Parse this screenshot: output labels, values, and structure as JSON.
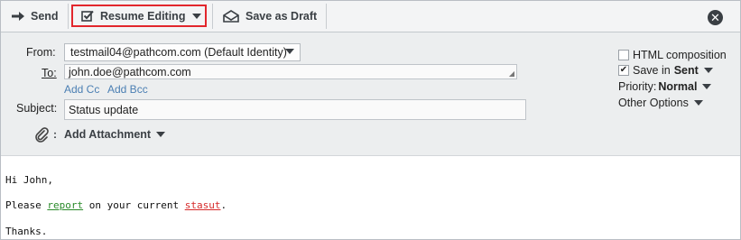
{
  "toolbar": {
    "send_label": "Send",
    "resume_label": "Resume Editing",
    "draft_label": "Save as Draft",
    "close_glyph": "✕"
  },
  "header": {
    "from_label": "From:",
    "from_value": "testmail04@pathcom.com (Default Identity)",
    "to_label": "To:",
    "to_value": "john.doe@pathcom.com",
    "add_cc": "Add Cc",
    "add_bcc": "Add Bcc",
    "subject_label": "Subject:",
    "subject_value": "Status update",
    "attach_separator": ":",
    "attach_label": "Add Attachment",
    "html_composition": "HTML composition",
    "save_in": "Save in",
    "save_in_folder": "Sent",
    "priority_label": "Priority:",
    "priority_value": "Normal",
    "other_options": "Other Options"
  },
  "message": {
    "line1": "Hi John,",
    "line2_pre": "Please ",
    "line2_word1": "report",
    "line2_mid": " on your current ",
    "line2_word2": "stasut",
    "line2_post": ".",
    "line3": "Thanks."
  },
  "colors": {
    "highlight_box": "#e2262c",
    "link": "#4b7fb3",
    "spell_ok": "#2a8a2a",
    "spell_err": "#d62a2a"
  },
  "icons": [
    "arrow-right-icon",
    "edit-checkbox-icon",
    "envelope-icon",
    "close-icon",
    "paperclip-icon",
    "chevron-down-icon",
    "checkbox-icon"
  ]
}
